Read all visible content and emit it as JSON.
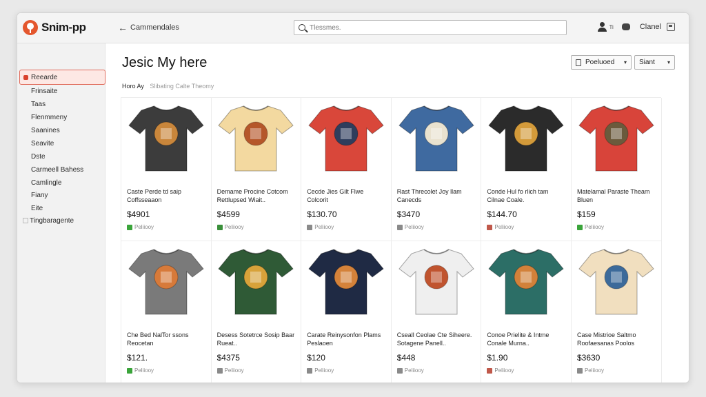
{
  "app": {
    "name": "Snim-pp"
  },
  "topbar": {
    "back_label": "Cammendales",
    "search_placeholder": "Tlessmes.",
    "user_label": "Ti",
    "cloud_label": "Clanel"
  },
  "sidebar": {
    "items": [
      {
        "label": "Reearde",
        "active": true
      },
      {
        "label": "Frinsaite"
      },
      {
        "label": "Taas"
      },
      {
        "label": "Flenmmeny"
      },
      {
        "label": "Saanines"
      },
      {
        "label": "Seavite"
      },
      {
        "label": "Dste"
      },
      {
        "label": "Carmeell Bahess"
      },
      {
        "label": "Camlingle"
      },
      {
        "label": "Fiany"
      },
      {
        "label": "Eite"
      },
      {
        "label": "Tingbaragente"
      }
    ]
  },
  "main": {
    "title": "Jesic My here",
    "sort_label": "Poeluoed",
    "start_label": "Siant",
    "filter_label": "Horo Ay",
    "filter_hint": "Slibating Calte Theomy"
  },
  "products": [
    {
      "name": "Caste Perde td saip Coffsseaaon",
      "price": "$4901",
      "ship": "Peliiooy",
      "shirt_color": "#3c3c3c",
      "art_color": "#c9863b",
      "ship_color": "#3aa43a"
    },
    {
      "name": "Demame Procine Cotcom Rettlupsed Wiait..",
      "price": "$4599",
      "ship": "Peliiooy",
      "shirt_color": "#f3d9a0",
      "art_color": "#b5572a",
      "ship_color": "#3a8f3a"
    },
    {
      "name": "Cecde Jies Gilt Flwe Colcorit",
      "price": "$130.70",
      "ship": "Peliiooy",
      "shirt_color": "#d9473a",
      "art_color": "#2f3d5c",
      "ship_color": "#8a8a8a"
    },
    {
      "name": "Rast Threcolet Joy llam Canecds",
      "price": "$3470",
      "ship": "Peliiooy",
      "shirt_color": "#3f6aa0",
      "art_color": "#e9e2cf",
      "ship_color": "#8a8a8a"
    },
    {
      "name": "Conde Hul fo rlich tam Cilnae Coale.",
      "price": "$144.70",
      "ship": "Peliiooy",
      "shirt_color": "#2b2b2b",
      "art_color": "#d39a3a",
      "ship_color": "#c0584a"
    },
    {
      "name": "Matelamal Paraste Theam Bluen",
      "price": "$159",
      "ship": "Peliiooy",
      "shirt_color": "#d8443a",
      "art_color": "#6b5a3c",
      "ship_color": "#3aa43a"
    },
    {
      "name": "Che Bed NalTor ssons Reocetan",
      "price": "$121.",
      "ship": "Peliiooy",
      "shirt_color": "#7a7a7a",
      "art_color": "#d77a3a",
      "ship_color": "#3aa43a"
    },
    {
      "name": "Desess Sotetrce Sosip Baar Rueat..",
      "price": "$4375",
      "ship": "Peliiooy",
      "shirt_color": "#2f5a36",
      "art_color": "#d8a23a",
      "ship_color": "#8a8a8a"
    },
    {
      "name": "Carate Reinysonfon Plams Peslaoen",
      "price": "$120",
      "ship": "Peliiooy",
      "shirt_color": "#1f2a44",
      "art_color": "#d4823a",
      "ship_color": "#8a8a8a"
    },
    {
      "name": "Cseall Ceolae Cte Siheere. Sotagene Panell..",
      "price": "$448",
      "ship": "Peliiooy",
      "shirt_color": "#efefef",
      "art_color": "#c0542f",
      "ship_color": "#8a8a8a"
    },
    {
      "name": "Conoe Prielite & Intme Conale Murna..",
      "price": "$1.90",
      "ship": "Peliiooy",
      "shirt_color": "#2c6e66",
      "art_color": "#d2813a",
      "ship_color": "#c0584a"
    },
    {
      "name": "Case Mistrioe Saltmo Roofaesanas Poolos",
      "price": "$3630",
      "ship": "Peliiooy",
      "shirt_color": "#f1dfbf",
      "art_color": "#3c6a9a",
      "ship_color": "#8a8a8a"
    }
  ],
  "colors": {
    "accent": "#e4572e",
    "active_bg": "#fde8e4",
    "active_border": "#e06a5a"
  }
}
